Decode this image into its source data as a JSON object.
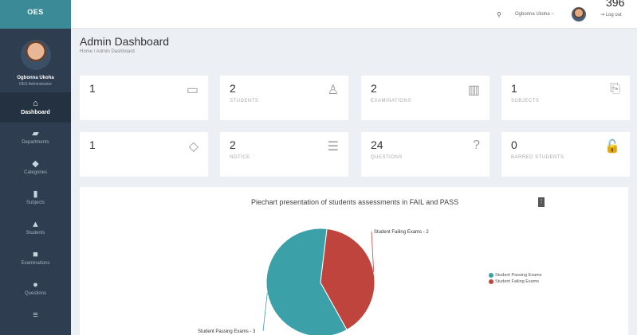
{
  "app": {
    "brand": "OES",
    "corner_text": "396"
  },
  "user": {
    "name": "Ogbonna Ukoha",
    "role": "OES Administrator"
  },
  "topbar": {
    "search_icon": "search-icon",
    "user_label": "Ogbonna Ukoha ~",
    "logout_label": "Log out"
  },
  "sidebar": {
    "items": [
      {
        "label": "Dashboard",
        "icon": "home-icon",
        "glyph": "⌂"
      },
      {
        "label": "Departments",
        "icon": "folder-icon",
        "glyph": "▰"
      },
      {
        "label": "Categories",
        "icon": "tag-icon",
        "glyph": "◆"
      },
      {
        "label": "Subjects",
        "icon": "file-icon",
        "glyph": "▮"
      },
      {
        "label": "Students",
        "icon": "student-icon",
        "glyph": "▲"
      },
      {
        "label": "Examinations",
        "icon": "book-icon",
        "glyph": "■"
      },
      {
        "label": "Questions",
        "icon": "question-icon",
        "glyph": "●"
      },
      {
        "label": "",
        "icon": "list-icon",
        "glyph": "≡"
      }
    ]
  },
  "header": {
    "title": "Admin Dashboard",
    "breadcrumb": "Home / Admin Dashboard"
  },
  "cards": [
    {
      "value": "1",
      "label": "",
      "icon": "folder-icon",
      "glyph": "▭"
    },
    {
      "value": "2",
      "label": "STUDENTS",
      "icon": "user-icon",
      "glyph": "♙"
    },
    {
      "value": "2",
      "label": "EXAMINATIONS",
      "icon": "book-icon",
      "glyph": "▥"
    },
    {
      "value": "1",
      "label": "SUBJECTS",
      "icon": "clipboard-icon",
      "glyph": "⎘"
    },
    {
      "value": "1",
      "label": "",
      "icon": "tag-icon",
      "glyph": "◇"
    },
    {
      "value": "2",
      "label": "NOTICE",
      "icon": "list-icon",
      "glyph": "☰"
    },
    {
      "value": "24",
      "label": "QUESTIONS",
      "icon": "question-icon",
      "glyph": "?"
    },
    {
      "value": "0",
      "label": "BARRED STUDENTS",
      "icon": "lock-icon",
      "glyph": "🔓"
    }
  ],
  "chart_data": {
    "type": "pie",
    "title": "Piechart presentation of students assessments in FAIL and PASS",
    "slices": [
      {
        "name": "Student Passing Exams",
        "value": 3,
        "label": "Student Passing Exams - 3",
        "color": "#3ba0a8"
      },
      {
        "name": "Student Failing Exams",
        "value": 2,
        "label": "Student Failing Exams - 2",
        "color": "#c0443e"
      }
    ],
    "legend_position": "right"
  }
}
